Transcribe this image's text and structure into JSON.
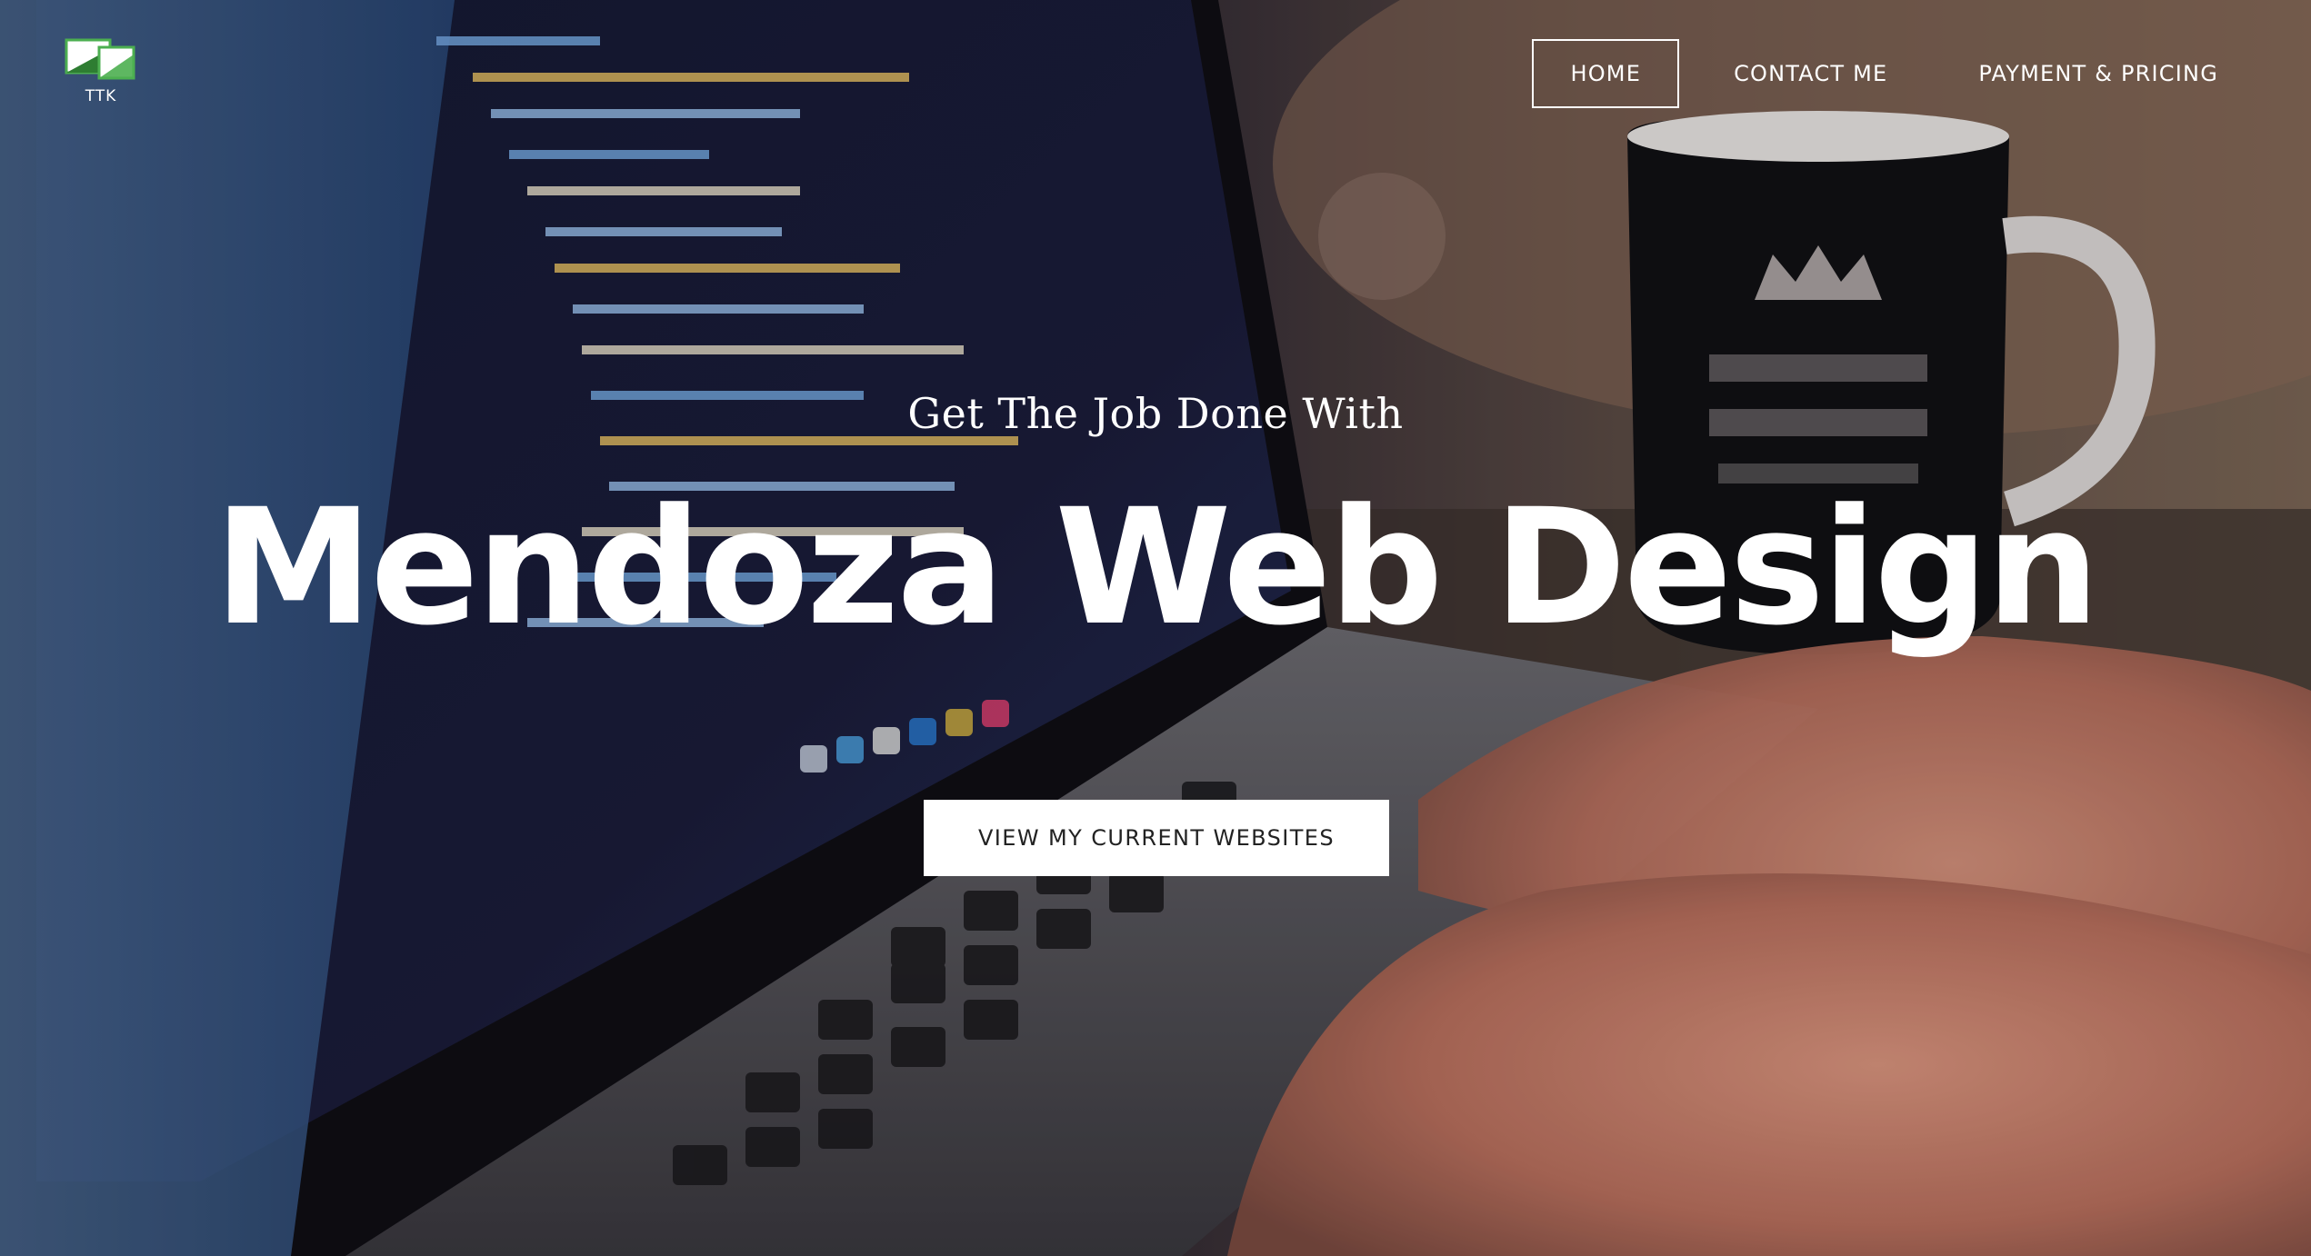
{
  "logo": {
    "text": "TTK",
    "accent_color": "#4caf50"
  },
  "nav": {
    "items": [
      {
        "label": "HOME",
        "active": true
      },
      {
        "label": "CONTACT ME",
        "active": false
      },
      {
        "label": "PAYMENT & PRICING",
        "active": false
      }
    ]
  },
  "hero": {
    "pretitle": "Get The Job Done With",
    "title": "Mendoza Web Design",
    "cta_label": "VIEW MY CURRENT WEBSITES",
    "background_image": "laptop-with-code-and-coffee-mug-photo"
  }
}
